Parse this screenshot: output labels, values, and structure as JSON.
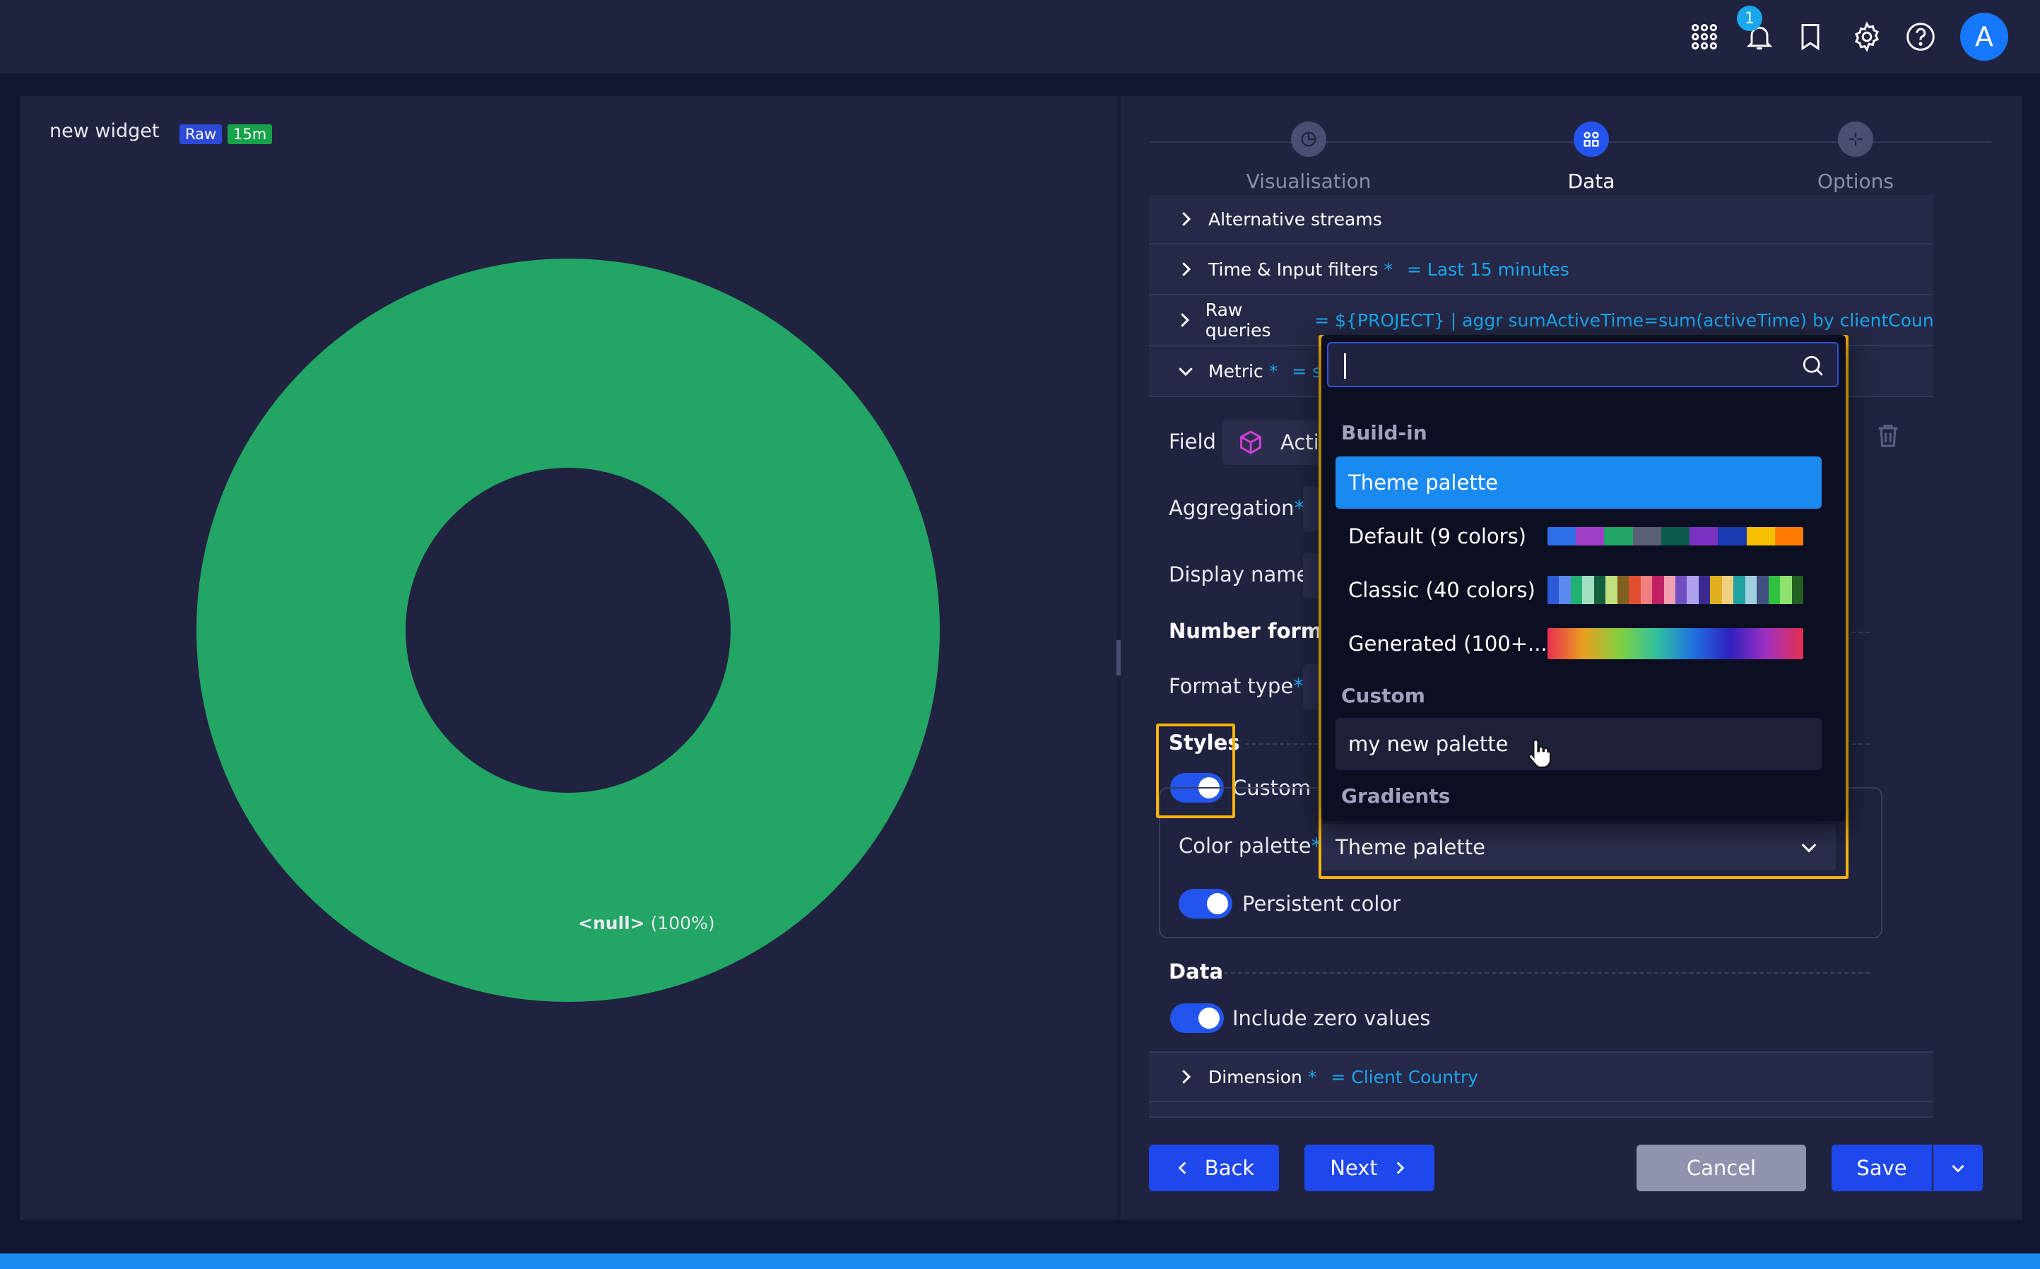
{
  "topbar": {
    "notification_count": "1",
    "avatar_letter": "A"
  },
  "widget": {
    "title": "new widget",
    "tags": [
      "Raw",
      "15m"
    ],
    "slice_label_bold": "<null>",
    "slice_label_pct": "(100%)"
  },
  "chart_data": {
    "type": "pie",
    "donut": true,
    "categories": [
      "<null>"
    ],
    "values": [
      100
    ],
    "colors": [
      "#22a565"
    ]
  },
  "steps": [
    {
      "label": "Visualisation",
      "active": false
    },
    {
      "label": "Data",
      "active": true
    },
    {
      "label": "Options",
      "active": false
    }
  ],
  "sections": {
    "alt_streams": "Alternative streams",
    "time_filters": {
      "label": "Time & Input filters",
      "star": "*",
      "value": "=  Last 15 minutes"
    },
    "raw_queries": {
      "label": "Raw queries",
      "value": "= ${PROJECT} | aggr sumActiveTime=sum(activeTime) by clientCountry as c"
    },
    "metric": {
      "label": "Metric",
      "star": "*",
      "value": "=  s"
    },
    "dimension": {
      "label": "Dimension",
      "star": "*",
      "value": "=  Client Country"
    }
  },
  "metric_form": {
    "field_label": "Field",
    "field_value": "Acti",
    "aggregation_label": "Aggregation",
    "display_name_label": "Display name",
    "number_format_head": "Number format",
    "format_type_label": "Format type",
    "styles_head": "Styles",
    "custom_colors_label": "Custom c",
    "color_palette_label": "Color palette",
    "color_palette_value": "Theme palette",
    "persistent_color_label": "Persistent color",
    "data_head": "Data",
    "include_zero_label": "Include zero values",
    "required_mark": "*"
  },
  "palette_dropdown": {
    "search_value": "",
    "groups": {
      "buildin": "Build-in",
      "custom": "Custom",
      "gradients": "Gradients"
    },
    "items": {
      "theme": "Theme palette",
      "default": "Default (9 colors)",
      "classic": "Classic (40 colors)",
      "generated": "Generated (100+...",
      "my_new": "my new palette"
    },
    "default_colors": [
      "#2e6ee6",
      "#a040c8",
      "#22a565",
      "#5a5e76",
      "#0c5a4a",
      "#7a30c0",
      "#1a3ab0",
      "#f6c000",
      "#ff7a00"
    ],
    "classic_colors": [
      "#2d5ad8",
      "#5a8af0",
      "#20b070",
      "#a0e0c0",
      "#126040",
      "#c0e080",
      "#806020",
      "#e05030",
      "#f08080",
      "#c02060",
      "#f0a0b0",
      "#7050c0",
      "#b0a0f0",
      "#3a2a90",
      "#e0b020",
      "#f0d080",
      "#20a0a0",
      "#a0d0e0",
      "#405080",
      "#30c040",
      "#90e070",
      "#206020"
    ]
  },
  "buttons": {
    "back": "Back",
    "next": "Next",
    "cancel": "Cancel",
    "save": "Save"
  }
}
